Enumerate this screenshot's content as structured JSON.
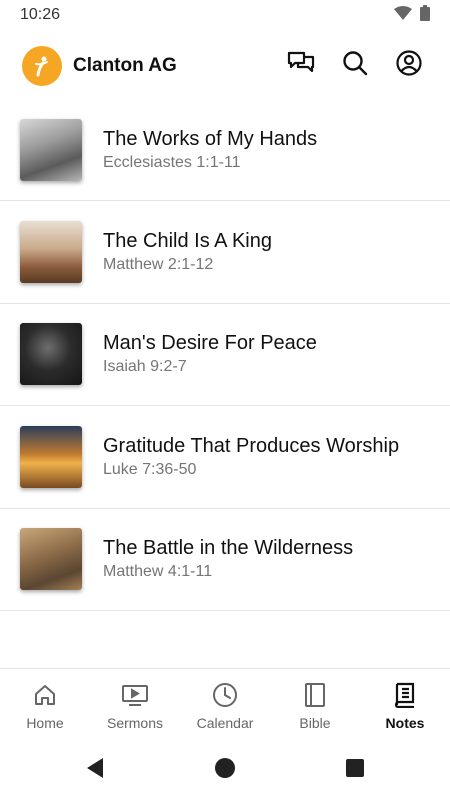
{
  "status_bar": {
    "time": "10:26"
  },
  "header": {
    "title": "Clanton AG"
  },
  "items": [
    {
      "title": "The Works of My Hands",
      "subtitle": "Ecclesiastes 1:1-11"
    },
    {
      "title": "The Child Is A King",
      "subtitle": "Matthew 2:1-12"
    },
    {
      "title": "Man's Desire For Peace",
      "subtitle": "Isaiah 9:2-7"
    },
    {
      "title": "Gratitude That Produces Worship",
      "subtitle": "Luke 7:36-50"
    },
    {
      "title": "The Battle in the Wilderness",
      "subtitle": "Matthew 4:1-11"
    }
  ],
  "nav": {
    "home": "Home",
    "sermons": "Sermons",
    "calendar": "Calendar",
    "bible": "Bible",
    "notes": "Notes"
  },
  "colors": {
    "logo": "#f5a623",
    "active": "#111111",
    "inactive": "#666666"
  }
}
